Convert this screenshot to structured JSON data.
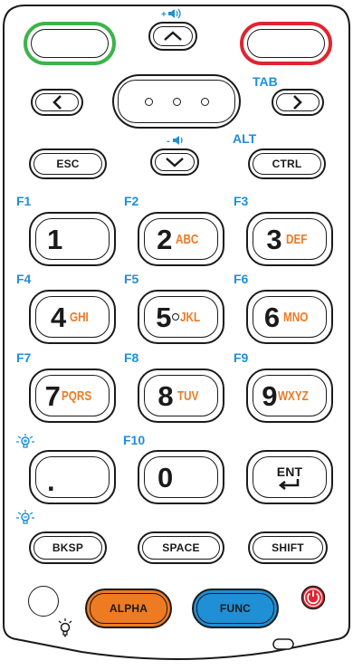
{
  "colors": {
    "outline": "#1a1a1a",
    "green": "#3db34a",
    "red": "#e0252f",
    "orange": "#ee7a22",
    "blue": "#1f8fd6"
  },
  "top": {
    "volume_up_icon": "speaker-plus-icon",
    "tab_label": "TAB",
    "alt_label": "ALT",
    "volume_down_icon": "speaker-minus-icon"
  },
  "keys": {
    "esc": "ESC",
    "ctrl": "CTRL",
    "bksp": "BKSP",
    "space": "SPACE",
    "shift": "SHIFT",
    "alpha": "ALPHA",
    "func": "FUNC",
    "ent": "ENT"
  },
  "fn_labels": {
    "f1": "F1",
    "f2": "F2",
    "f3": "F3",
    "f4": "F4",
    "f5": "F5",
    "f6": "F6",
    "f7": "F7",
    "f8": "F8",
    "f9": "F9",
    "f10": "F10"
  },
  "numpad": {
    "k1": {
      "digit": "1",
      "letters": ""
    },
    "k2": {
      "digit": "2",
      "letters": "ABC"
    },
    "k3": {
      "digit": "3",
      "letters": "DEF"
    },
    "k4": {
      "digit": "4",
      "letters": "GHI"
    },
    "k5": {
      "digit": "5",
      "letters": "JKL"
    },
    "k6": {
      "digit": "6",
      "letters": "MNO"
    },
    "k7": {
      "digit": "7",
      "letters": "PQRS"
    },
    "k8": {
      "digit": "8",
      "letters": "TUV"
    },
    "k9": {
      "digit": "9",
      "letters": "WXYZ"
    },
    "dot": ".",
    "k0": "0"
  }
}
